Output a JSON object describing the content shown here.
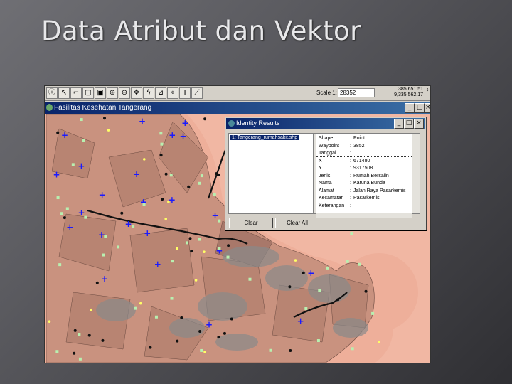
{
  "slide": {
    "title": "Data Atribut dan Vektor"
  },
  "app": {
    "toolbar": {
      "icons": [
        {
          "name": "info-icon",
          "glyph": "ⓘ"
        },
        {
          "name": "pointer-icon",
          "glyph": "↖"
        },
        {
          "name": "vertex-icon",
          "glyph": "⌐"
        },
        {
          "name": "zoom-box-icon",
          "glyph": "▢"
        },
        {
          "name": "zoom-extent-icon",
          "glyph": "▣"
        },
        {
          "name": "zoom-in-icon",
          "glyph": "⊕"
        },
        {
          "name": "zoom-out-icon",
          "glyph": "⊖"
        },
        {
          "name": "pan-icon",
          "glyph": "✥"
        },
        {
          "name": "hotlink-icon",
          "glyph": "ϟ"
        },
        {
          "name": "measure-icon",
          "glyph": "⊿"
        },
        {
          "name": "label-icon",
          "glyph": "⌖"
        },
        {
          "name": "text-icon",
          "glyph": "T"
        },
        {
          "name": "draw-icon",
          "glyph": "⟋"
        }
      ],
      "scale_label": "Scale 1:",
      "scale_value": "28352",
      "coord_x": "385,651.51",
      "coord_y": "9,335,562.17"
    },
    "view": {
      "title": "Fasilitas Kesehatan Tangerang"
    },
    "identify": {
      "title": "Identity Results",
      "selected_layer": "1: Tangerang_rumahsakit.shp",
      "rows": [
        {
          "field": "Shape",
          "value": "Point"
        },
        {
          "field": "Waypoint",
          "value": "3852"
        },
        {
          "field": "Tanggal",
          "value": ""
        },
        {
          "field": "X",
          "value": "671480"
        },
        {
          "field": "Y",
          "value": "9317508"
        },
        {
          "field": "Jenis",
          "value": "Rumah Bersalin"
        },
        {
          "field": "Nama",
          "value": "Karuna Bunda"
        },
        {
          "field": "Alamat",
          "value": "Jalan Raya Pasarkemis"
        },
        {
          "field": "Kecamatan",
          "value": "Pasarkemis"
        },
        {
          "field": "Keterangan",
          "value": ""
        }
      ],
      "clear_label": "Clear",
      "clear_all_label": "Clear All"
    }
  },
  "colors": {
    "buffer": "#f1b7a3",
    "district": "#c9927f",
    "road": "#111111",
    "hospital": "#1a1aff",
    "clinic": "#b8f0b0",
    "other": "#ffff66"
  }
}
